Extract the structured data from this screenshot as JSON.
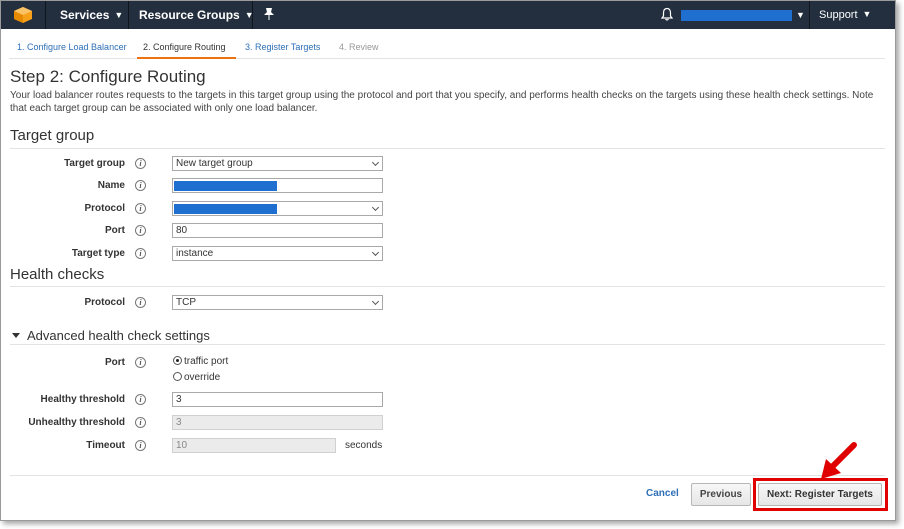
{
  "nav": {
    "services_label": "Services",
    "resource_groups_label": "Resource Groups",
    "support_label": "Support"
  },
  "wizard": {
    "tabs": [
      {
        "label": "1. Configure Load Balancer"
      },
      {
        "label": "2. Configure Routing"
      },
      {
        "label": "3. Register Targets"
      },
      {
        "label": "4. Review"
      }
    ]
  },
  "page": {
    "title": "Step 2: Configure Routing",
    "intro": "Your load balancer routes requests to the targets in this target group using the protocol and port that you specify, and performs health checks on the targets using these health check settings. Note that each target group can be associated with only one load balancer."
  },
  "target_group": {
    "section_title": "Target group",
    "target_group_label": "Target group",
    "target_group_value": "New target group",
    "name_label": "Name",
    "protocol_label": "Protocol",
    "port_label": "Port",
    "port_value": "80",
    "target_type_label": "Target type",
    "target_type_value": "instance"
  },
  "health_checks": {
    "section_title": "Health checks",
    "protocol_label": "Protocol",
    "protocol_value": "TCP"
  },
  "advanced": {
    "section_title": "Advanced health check settings",
    "port_label": "Port",
    "port_option_traffic": "traffic port",
    "port_option_override": "override",
    "healthy_threshold_label": "Healthy threshold",
    "healthy_threshold_value": "3",
    "unhealthy_threshold_label": "Unhealthy threshold",
    "unhealthy_threshold_value": "3",
    "timeout_label": "Timeout",
    "timeout_value": "10",
    "timeout_unit": "seconds"
  },
  "footer": {
    "cancel_label": "Cancel",
    "previous_label": "Previous",
    "next_label": "Next: Register Targets"
  },
  "colors": {
    "nav_bg": "#232f3e",
    "accent_orange": "#ec7211",
    "link_blue": "#2e6fb7",
    "redaction_blue": "#1f6fd1",
    "annotation_red": "#e00000"
  }
}
